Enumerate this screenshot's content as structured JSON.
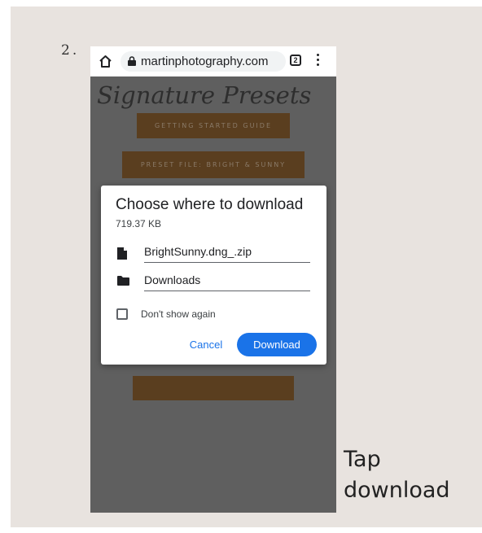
{
  "step": {
    "number": "2."
  },
  "browser": {
    "url": "martinphotography.com",
    "tab_count": "2",
    "icons": {
      "home": "home-icon",
      "lock": "lock-icon",
      "tabs": "tab-switcher-icon",
      "menu": "more-vert-icon"
    }
  },
  "page": {
    "heading": "Signature Presets",
    "buttons": [
      "GETTING STARTED GUIDE",
      "PRESET FILE: BRIGHT & SUNNY"
    ]
  },
  "dialog": {
    "title": "Choose where to download",
    "size": "719.37 KB",
    "filename": "BrightSunny.dng_.zip",
    "location": "Downloads",
    "dont_show_label": "Don't show again",
    "dont_show_checked": false,
    "cancel_label": "Cancel",
    "download_label": "Download",
    "icons": {
      "file": "file-icon",
      "folder": "folder-icon"
    }
  },
  "caption": {
    "line1": "Tap",
    "line2": "download"
  },
  "colors": {
    "card_bg": "#e8e3df",
    "page_dim": "#5f5f5f",
    "accent_blue": "#1a73e8",
    "button_brown": "#5a3e1f"
  }
}
